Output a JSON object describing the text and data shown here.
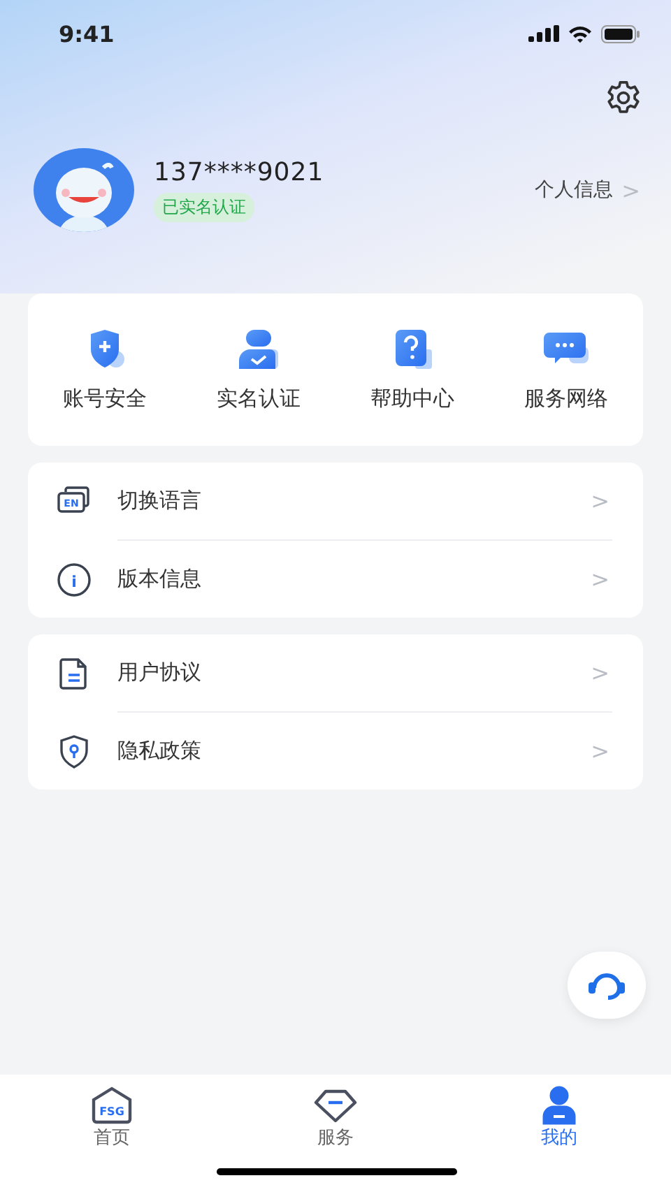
{
  "status_bar": {
    "time": "9:41"
  },
  "profile": {
    "phone": "137****9021",
    "badge": "已实名认证",
    "link": "个人信息",
    "link_chevron": ">"
  },
  "shortcuts": [
    {
      "kind": "shield",
      "label": "账号安全"
    },
    {
      "kind": "person",
      "label": "实名认证"
    },
    {
      "kind": "help",
      "label": "帮助中心"
    },
    {
      "kind": "chat",
      "label": "服务网络"
    }
  ],
  "menu_groups": [
    [
      {
        "kind": "language",
        "icon_text": "EN",
        "label": "切换语言",
        "chevron": ">"
      },
      {
        "kind": "info",
        "icon_text": "i",
        "label": "版本信息",
        "chevron": ">"
      }
    ],
    [
      {
        "kind": "document",
        "label": "用户协议",
        "chevron": ">"
      },
      {
        "kind": "privacy",
        "label": "隐私政策",
        "chevron": ">"
      }
    ]
  ],
  "tabs": [
    {
      "kind": "home",
      "icon_text": "FSG",
      "label": "首页",
      "selected": false
    },
    {
      "kind": "service",
      "label": "服务",
      "selected": false
    },
    {
      "kind": "mine",
      "label": "我的",
      "selected": true
    }
  ]
}
